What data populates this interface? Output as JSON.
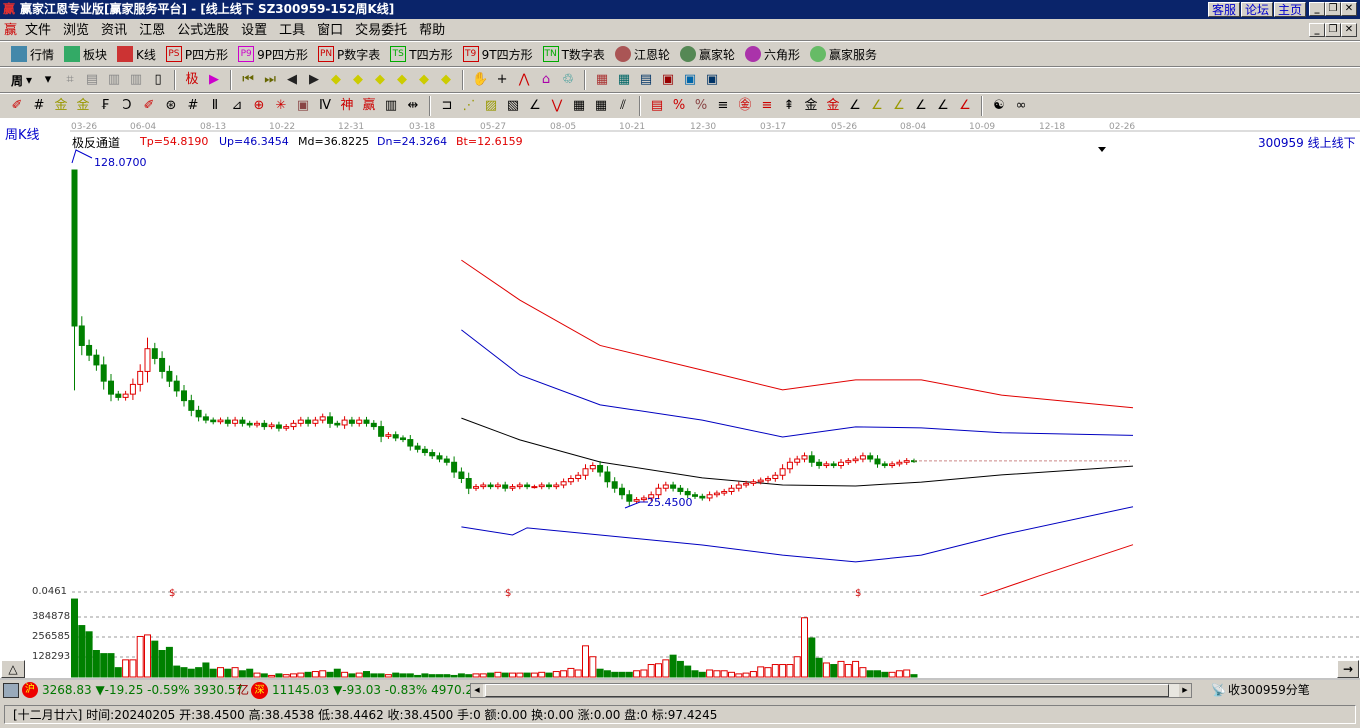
{
  "window": {
    "title": "赢家江恩专业版[赢家服务平台] - [线上线下   SZ300959-152周K线]",
    "links": [
      "客服",
      "论坛",
      "主页"
    ]
  },
  "menu": [
    "文件",
    "浏览",
    "资讯",
    "江恩",
    "公式选股",
    "设置",
    "工具",
    "窗口",
    "交易委托",
    "帮助"
  ],
  "toolbar1": [
    {
      "icon": "grid-icon",
      "label": "行情"
    },
    {
      "icon": "blocks-icon",
      "label": "板块"
    },
    {
      "icon": "candle-icon",
      "label": "K线"
    },
    {
      "icon": "ps-icon",
      "badge": "PS",
      "label": "P四方形"
    },
    {
      "icon": "p9-icon",
      "badge": "P9",
      "label": "9P四方形"
    },
    {
      "icon": "pn-icon",
      "badge": "PN",
      "label": "P数字表"
    },
    {
      "icon": "ts-icon",
      "badge": "TS",
      "label": "T四方形"
    },
    {
      "icon": "t9-icon",
      "badge": "T9",
      "label": "9T四方形"
    },
    {
      "icon": "tn-icon",
      "badge": "TN",
      "label": "T数字表"
    },
    {
      "icon": "wheel-icon",
      "label": "江恩轮"
    },
    {
      "icon": "winner-wheel-icon",
      "label": "赢家轮"
    },
    {
      "icon": "hexagon-icon",
      "label": "六角形"
    },
    {
      "icon": "dollar-icon",
      "label": "赢家服务"
    }
  ],
  "period": "周",
  "chart": {
    "indicator_label": "周K线",
    "channel_name": "极反通道",
    "params": [
      {
        "text": "Tp=54.8190",
        "color": "#e00000"
      },
      {
        "text": "Up=46.3454",
        "color": "#0000c0"
      },
      {
        "text": "Md=36.8225",
        "color": "#000000"
      },
      {
        "text": "Dn=24.3264",
        "color": "#0000c0"
      },
      {
        "text": "Bt=12.6159",
        "color": "#e00000"
      }
    ],
    "stock_label": "300959  线上线下",
    "high_label": "128.0700",
    "low_label": "25.4500",
    "dates": [
      "03-26",
      "06-04",
      "08-13",
      "10-22",
      "12-31",
      "03-18",
      "05-27",
      "08-05",
      "10-21",
      "12-30",
      "03-17",
      "05-26",
      "08-04",
      "10-09",
      "12-18",
      "02-26"
    ],
    "vol_axis": [
      "0.0461",
      "384878",
      "256585",
      "128293"
    ],
    "up_color": "#e00000",
    "down_color": "#008000"
  },
  "chart_data": {
    "type": "candlestick",
    "title": "SZ300959-152周K线",
    "first_open": 128.07,
    "close": [
      80,
      74,
      71,
      68,
      63,
      59,
      58,
      59,
      62,
      66,
      73,
      70,
      66,
      63,
      60,
      57,
      54,
      52,
      51,
      50.5,
      51,
      50,
      51,
      50,
      49.5,
      50,
      49,
      49.5,
      48.5,
      49,
      50,
      51,
      50,
      51,
      52,
      50,
      49.5,
      51,
      50,
      51,
      50,
      49,
      46,
      46.5,
      45.5,
      45,
      43,
      42,
      41,
      40,
      39,
      38,
      35,
      33,
      30,
      30.5,
      31,
      30.5,
      31,
      30,
      30.5,
      31,
      30.5,
      30.5,
      31,
      30.5,
      31,
      32,
      33,
      34,
      36,
      37,
      35,
      32,
      30,
      28,
      26,
      26.5,
      27,
      28,
      30,
      31,
      30,
      29,
      28,
      27.5,
      27,
      28,
      28.5,
      29,
      30,
      31,
      31.5,
      32,
      32.5,
      33,
      34,
      36,
      38,
      39,
      40,
      38,
      37,
      37.5,
      37,
      38,
      38.5,
      39,
      40,
      39,
      37.5,
      37,
      37.5,
      38,
      38.5,
      38.45
    ],
    "volume_k": [
      500,
      330,
      290,
      170,
      150,
      150,
      60,
      110,
      110,
      260,
      270,
      230,
      170,
      190,
      70,
      60,
      50,
      60,
      90,
      50,
      60,
      50,
      60,
      40,
      50,
      25,
      20,
      10,
      20,
      15,
      20,
      25,
      30,
      35,
      40,
      30,
      50,
      30,
      20,
      25,
      35,
      20,
      20,
      15,
      25,
      20,
      20,
      10,
      20,
      15,
      15,
      15,
      10,
      20,
      15,
      20,
      20,
      25,
      30,
      25,
      25,
      25,
      25,
      25,
      30,
      25,
      35,
      40,
      55,
      45,
      200,
      130,
      50,
      40,
      30,
      30,
      30,
      40,
      45,
      80,
      85,
      110,
      140,
      100,
      70,
      40,
      30,
      45,
      40,
      40,
      30,
      20,
      25,
      35,
      65,
      60,
      80,
      80,
      80,
      130,
      380,
      250,
      120,
      90,
      80,
      100,
      80,
      100,
      60,
      40,
      40,
      30,
      30,
      40,
      45,
      15
    ],
    "channel": [
      {
        "name": "Tp",
        "color": "#e00000",
        "points": [
          [
            53,
            100.3
          ],
          [
            61,
            88
          ],
          [
            72,
            74
          ],
          [
            86,
            66.4
          ],
          [
            97,
            60.3
          ],
          [
            107,
            63.4
          ],
          [
            116,
            63.4
          ],
          [
            127,
            58.7
          ],
          [
            145,
            54.8
          ]
        ]
      },
      {
        "name": "Up",
        "color": "#0000c0",
        "points": [
          [
            53,
            78.8
          ],
          [
            61,
            64.9
          ],
          [
            72,
            55.7
          ],
          [
            86,
            51
          ],
          [
            97,
            45.8
          ],
          [
            107,
            48.9
          ],
          [
            116,
            48.6
          ],
          [
            127,
            47.1
          ],
          [
            145,
            46.3
          ]
        ]
      },
      {
        "name": "Md",
        "color": "#000000",
        "points": [
          [
            53,
            51.6
          ],
          [
            61,
            44.9
          ],
          [
            72,
            38.1
          ],
          [
            86,
            33.2
          ],
          [
            97,
            31
          ],
          [
            107,
            30.7
          ],
          [
            116,
            31.9
          ],
          [
            127,
            34.1
          ],
          [
            145,
            36.8
          ]
        ]
      },
      {
        "name": "Dn",
        "color": "#0000c0",
        "points": [
          [
            53,
            18.1
          ],
          [
            60,
            15.6
          ],
          [
            62,
            17.8
          ],
          [
            72,
            15.6
          ],
          [
            86,
            12.5
          ],
          [
            97,
            9.4
          ],
          [
            107,
            7.3
          ],
          [
            116,
            9.4
          ],
          [
            127,
            15.6
          ],
          [
            145,
            24.3
          ]
        ]
      },
      {
        "name": "Bt",
        "color": "#e00000",
        "points": [
          [
            124,
            -3.3
          ],
          [
            132,
            2.9
          ],
          [
            145,
            12.6
          ]
        ]
      }
    ],
    "last_price": 38.45,
    "ylim": [
      0,
      128.07
    ]
  },
  "status1": {
    "sh_badge": "沪",
    "sh": "3268.83 ▼-19.25 -0.59% 3930.57",
    "sh_unit": "亿",
    "sz_badge": "深",
    "sz": "11145.03 ▼-93.03 -0.83% 4970.2",
    "receive": "收300959分笔"
  },
  "status2": "[十二月廿六] 时间:20240205 开:38.4500 高:38.4538 低:38.4462 收:38.4500 手:0 额:0.00 换:0.00 涨:0.00 盘:0 标:97.4245"
}
